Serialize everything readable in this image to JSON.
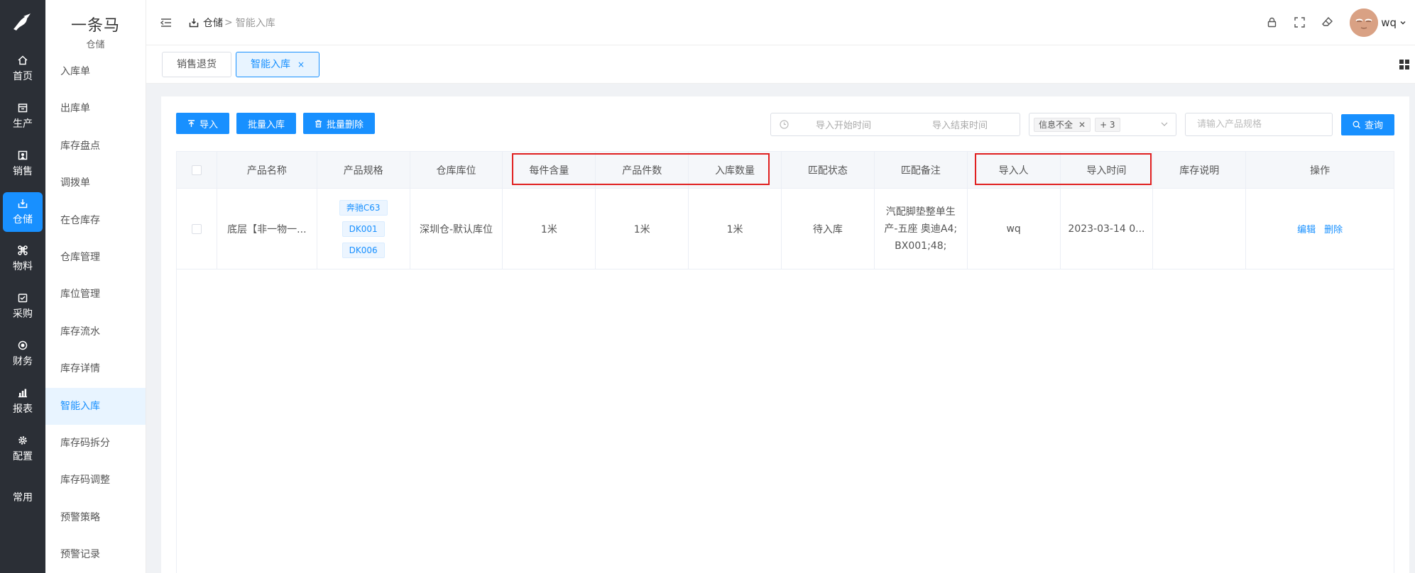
{
  "rail": {
    "items": [
      {
        "label": "首页",
        "icon": "home-icon"
      },
      {
        "label": "生产",
        "icon": "factory-icon"
      },
      {
        "label": "销售",
        "icon": "sales-icon"
      },
      {
        "label": "仓储",
        "icon": "warehouse-icon",
        "active": true
      },
      {
        "label": "物料",
        "icon": "command-icon"
      },
      {
        "label": "采购",
        "icon": "purchase-icon"
      },
      {
        "label": "财务",
        "icon": "finance-icon"
      },
      {
        "label": "报表",
        "icon": "report-icon"
      },
      {
        "label": "配置",
        "icon": "gear-icon"
      },
      {
        "label": "常用",
        "icon": ""
      }
    ]
  },
  "sidebar": {
    "brand_title": "一条马",
    "brand_sub": "仓储",
    "items": [
      {
        "label": "入库单"
      },
      {
        "label": "出库单"
      },
      {
        "label": "库存盘点"
      },
      {
        "label": "调拨单"
      },
      {
        "label": "在仓库存"
      },
      {
        "label": "仓库管理"
      },
      {
        "label": "库位管理"
      },
      {
        "label": "库存流水"
      },
      {
        "label": "库存详情"
      },
      {
        "label": "智能入库",
        "active": true
      },
      {
        "label": "库存码拆分"
      },
      {
        "label": "库存码调整"
      },
      {
        "label": "预警策略"
      },
      {
        "label": "预警记录"
      }
    ]
  },
  "header": {
    "breadcrumb": [
      "仓储",
      ">",
      "智能入库"
    ],
    "username": "wq"
  },
  "tabs": [
    {
      "label": "销售退货",
      "active": false
    },
    {
      "label": "智能入库",
      "active": true,
      "close": "×"
    }
  ],
  "toolbar": {
    "import_label": "导入",
    "batch_in_label": "批量入库",
    "batch_delete_label": "批量删除"
  },
  "filters": {
    "start_placeholder": "导入开始时间",
    "end_placeholder": "导入结束时间",
    "status_chip": "信息不全",
    "more_chip": "+ 3",
    "search_placeholder": "请输入产品规格",
    "query_label": "查询"
  },
  "table": {
    "columns": [
      "产品名称",
      "产品规格",
      "仓库库位",
      "每件含量",
      "产品件数",
      "入库数量",
      "匹配状态",
      "匹配备注",
      "导入人",
      "导入时间",
      "库存说明",
      "操作"
    ],
    "rows": [
      {
        "name": "底层【非一物一...",
        "specs": [
          "奔驰C63",
          "DK001",
          "DK006"
        ],
        "location": "深圳仓-默认库位",
        "per_piece": "1米",
        "pieces": "1米",
        "quantity": "1米",
        "status": "待入库",
        "remark_lines": [
          "汽配脚垫整单生",
          "产-五座 奥迪A4;",
          "BX001;48;"
        ],
        "importer": "wq",
        "import_time": "2023-03-14 0...",
        "stock_note": "",
        "ops": [
          "编辑",
          "删除"
        ]
      }
    ]
  },
  "colors": {
    "primary": "#1890ff",
    "rail_bg": "#2b2f36",
    "highlight": "#e02020"
  }
}
